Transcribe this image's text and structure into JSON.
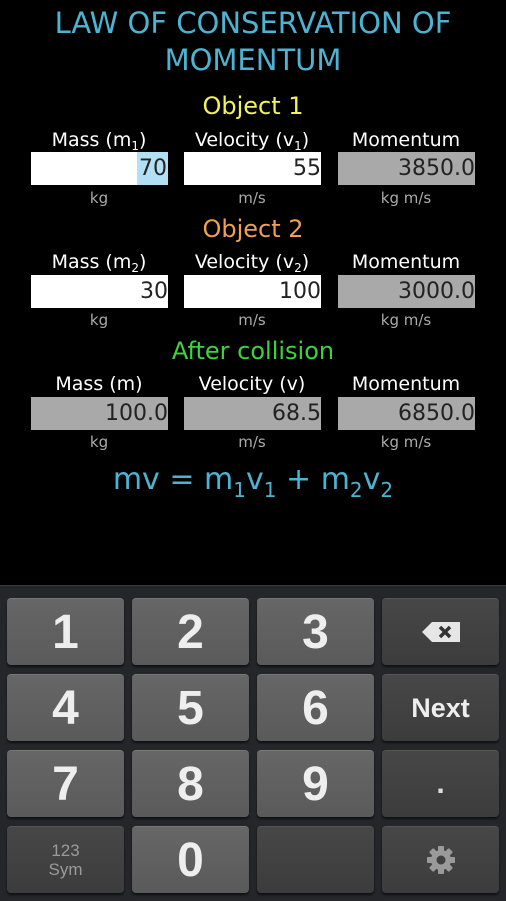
{
  "title": {
    "line1": "LAW OF CONSERVATION OF",
    "line2": "MOMENTUM"
  },
  "colors": {
    "title": "#4eb3d3",
    "object1": "#f2f25a",
    "object2": "#f0a050",
    "after": "#3ed23e"
  },
  "object1": {
    "heading": "Object 1",
    "mass_label": "Mass (m",
    "mass_sub": "1",
    "mass_close": ")",
    "velocity_label": "Velocity (v",
    "velocity_sub": "1",
    "velocity_close": ")",
    "momentum_label": "Momentum",
    "mass_value": "70",
    "velocity_value": "55",
    "momentum_value": "3850.0",
    "mass_unit": "kg",
    "velocity_unit": "m/s",
    "momentum_unit": "kg m/s"
  },
  "object2": {
    "heading": "Object 2",
    "mass_label": "Mass (m",
    "mass_sub": "2",
    "mass_close": ")",
    "velocity_label": "Velocity (v",
    "velocity_sub": "2",
    "velocity_close": ")",
    "momentum_label": "Momentum",
    "mass_value": "30",
    "velocity_value": "100",
    "momentum_value": "3000.0",
    "mass_unit": "kg",
    "velocity_unit": "m/s",
    "momentum_unit": "kg m/s"
  },
  "after": {
    "heading": "After collision",
    "mass_label": "Mass (m)",
    "velocity_label": "Velocity (v)",
    "momentum_label": "Momentum",
    "mass_value": "100.0",
    "velocity_value": "68.5",
    "momentum_value": "6850.0",
    "mass_unit": "kg",
    "velocity_unit": "m/s",
    "momentum_unit": "kg m/s"
  },
  "formula": {
    "lhs": "mv = m",
    "s1": "1",
    "v1": "v",
    "s2": "1",
    "plus": " + m",
    "s3": "2",
    "v2": "v",
    "s4": "2"
  },
  "keyboard": {
    "k1": "1",
    "k2": "2",
    "k3": "3",
    "backspace": "backspace-icon",
    "k4": "4",
    "k5": "5",
    "k6": "6",
    "next": "Next",
    "k7": "7",
    "k8": "8",
    "k9": "9",
    "dot": ".",
    "sym1": "123",
    "sym2": "Sym",
    "k0": "0",
    "settings": "gear-icon"
  }
}
